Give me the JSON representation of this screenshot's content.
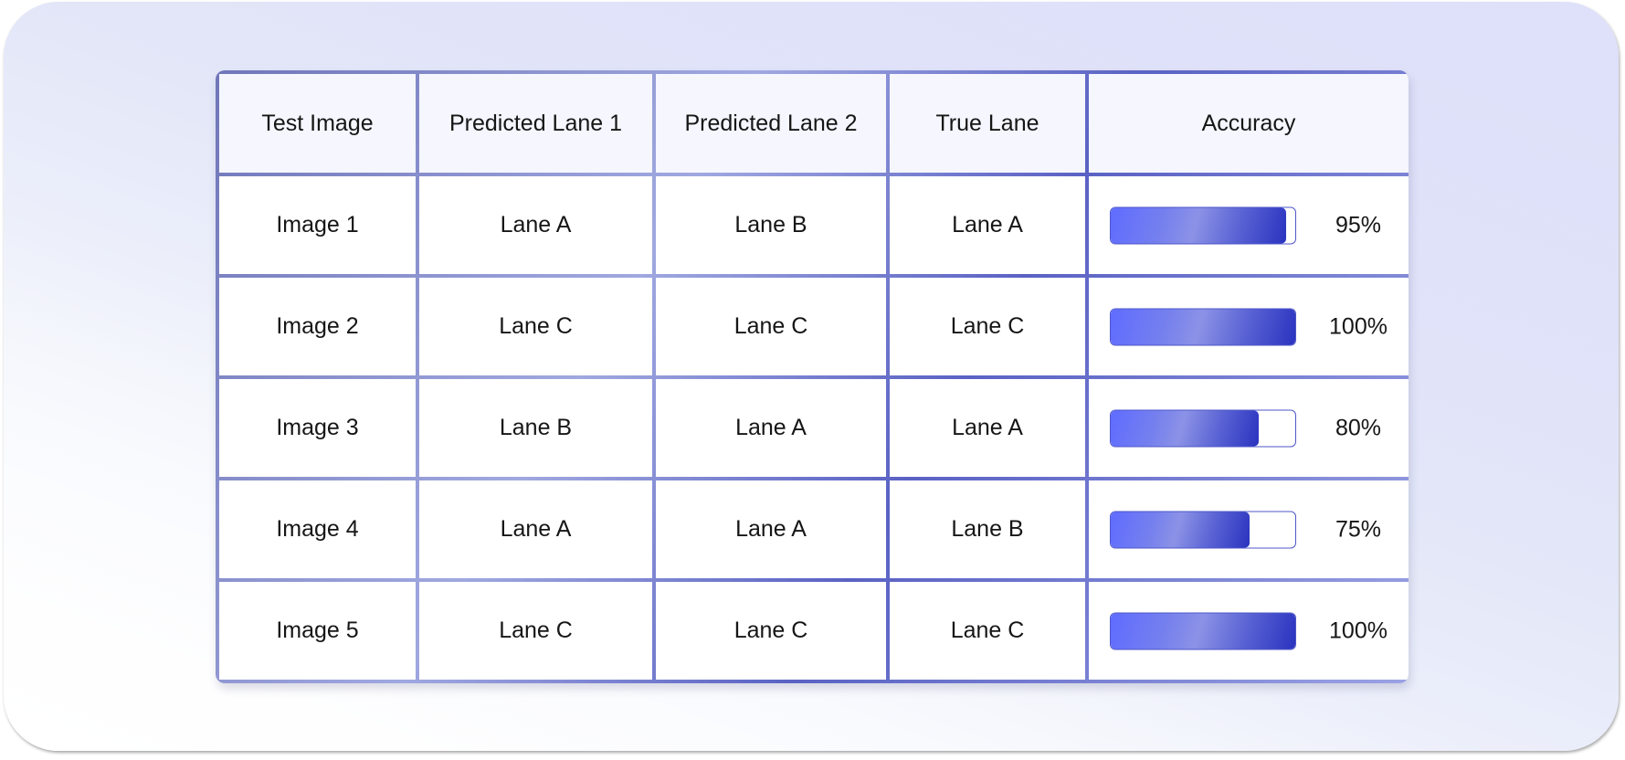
{
  "table": {
    "headers": [
      "Test Image",
      "Predicted Lane 1",
      "Predicted Lane 2",
      "True Lane",
      "Accuracy"
    ],
    "rows": [
      {
        "image": "Image 1",
        "pred1": "Lane A",
        "pred2": "Lane B",
        "true_lane": "Lane A",
        "accuracy": 95,
        "accuracy_label": "95%"
      },
      {
        "image": "Image 2",
        "pred1": "Lane C",
        "pred2": "Lane C",
        "true_lane": "Lane C",
        "accuracy": 100,
        "accuracy_label": "100%"
      },
      {
        "image": "Image 3",
        "pred1": "Lane B",
        "pred2": "Lane A",
        "true_lane": "Lane A",
        "accuracy": 80,
        "accuracy_label": "80%"
      },
      {
        "image": "Image 4",
        "pred1": "Lane A",
        "pred2": "Lane A",
        "true_lane": "Lane B",
        "accuracy": 75,
        "accuracy_label": "75%"
      },
      {
        "image": "Image 5",
        "pred1": "Lane C",
        "pred2": "Lane C",
        "true_lane": "Lane C",
        "accuracy": 100,
        "accuracy_label": "100%"
      }
    ]
  },
  "colors": {
    "grid_line": "#6f77c6",
    "header_bg": "#f5f6fe",
    "bar_start": "#5f6cff",
    "bar_end": "#2a33bf"
  }
}
